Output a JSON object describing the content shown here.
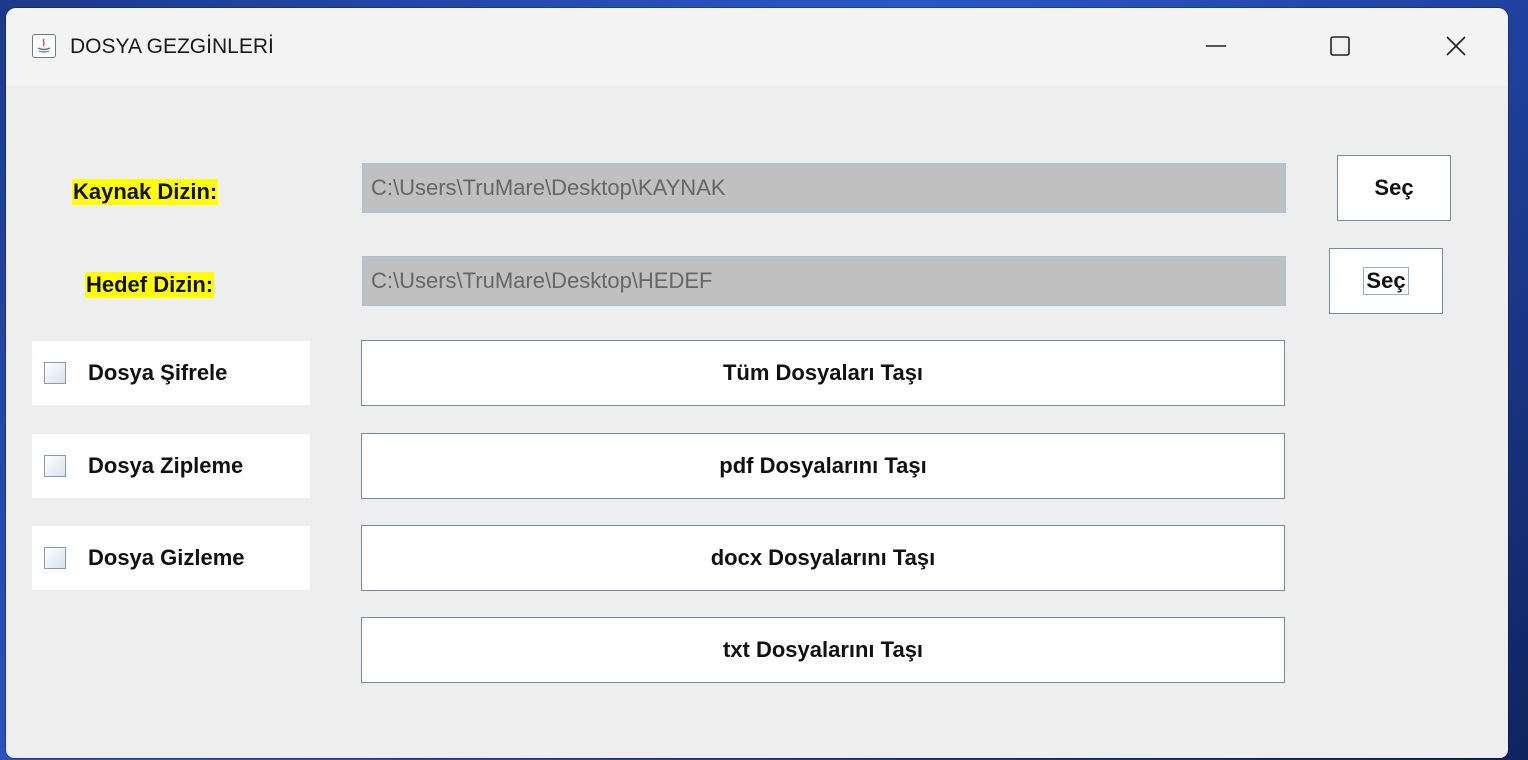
{
  "window": {
    "title": "DOSYA GEZGİNLERİ",
    "app_icon": "java-icon",
    "controls": [
      "minimize-icon",
      "maximize-icon",
      "close-icon"
    ]
  },
  "source": {
    "label": "Kaynak Dizin:",
    "path": "C:\\Users\\TruMare\\Desktop\\KAYNAK",
    "select_label": "Seç"
  },
  "target": {
    "label": "Hedef Dizin:",
    "path": "C:\\Users\\TruMare\\Desktop\\HEDEF",
    "select_label": "Seç"
  },
  "options": [
    {
      "label": "Dosya Şifrele",
      "checked": false
    },
    {
      "label": "Dosya Zipleme",
      "checked": false
    },
    {
      "label": "Dosya Gizleme",
      "checked": false
    }
  ],
  "actions": [
    {
      "label": "Tüm Dosyaları Taşı"
    },
    {
      "label": "pdf Dosyalarını Taşı"
    },
    {
      "label": "docx Dosyalarını Taşı"
    },
    {
      "label": "txt Dosyalarını Taşı"
    }
  ],
  "colors": {
    "label_highlight": "#ffff00",
    "path_field_bg": "#c0c0c0",
    "window_bg": "#eeeeee"
  }
}
